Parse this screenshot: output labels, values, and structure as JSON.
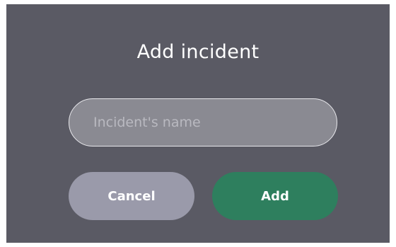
{
  "dialog": {
    "title": "Add incident",
    "name_input": {
      "value": "",
      "placeholder": "Incident's name"
    },
    "buttons": {
      "cancel_label": "Cancel",
      "add_label": "Add"
    }
  },
  "colors": {
    "dialog_background": "#5a5a64",
    "input_background": "#8a8a92",
    "cancel_button": "#9a9aaa",
    "add_button": "#2e7f5e"
  }
}
